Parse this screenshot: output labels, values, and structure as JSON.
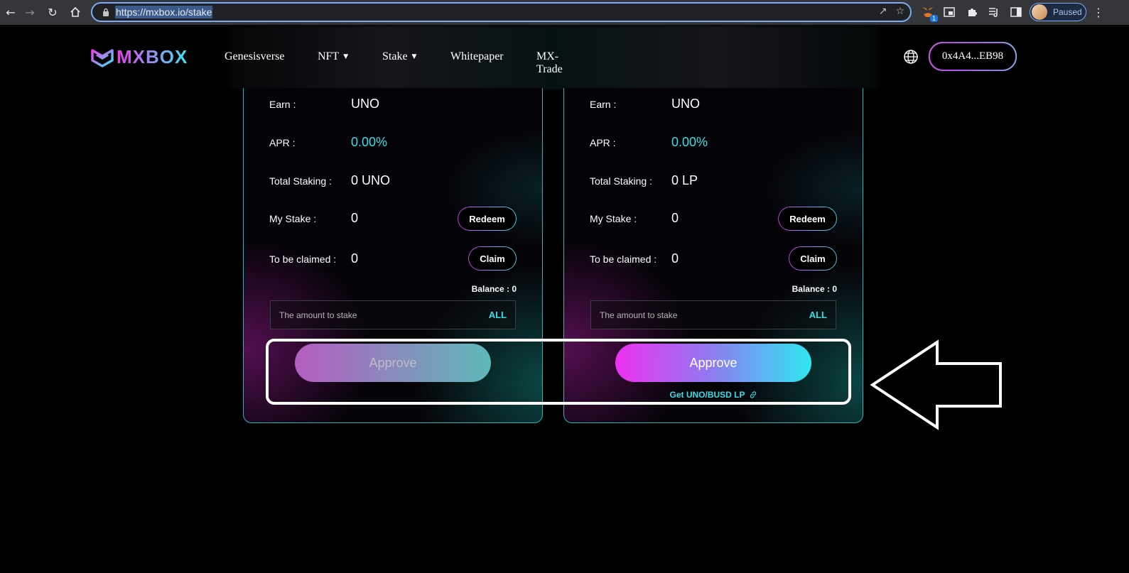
{
  "browser": {
    "url": "https://mxbox.io/stake",
    "profile_status": "Paused",
    "extension_badge": "1"
  },
  "site": {
    "logo_text": "MXBOX",
    "nav": [
      "Genesisverse",
      "NFT",
      "Stake",
      "Whitepaper",
      "MX-Trade"
    ],
    "wallet_address": "0x4A4...EB98"
  },
  "cards": [
    {
      "earn_label": "Earn :",
      "earn_value": "UNO",
      "apr_label": "APR :",
      "apr_value": "0.00%",
      "total_label": "Total Staking :",
      "total_value": "0 UNO",
      "mystake_label": "My Stake :",
      "mystake_value": "0",
      "redeem_label": "Redeem",
      "claimed_label": "To be claimed :",
      "claimed_value": "0",
      "claim_label": "Claim",
      "balance": "Balance : 0",
      "amount_placeholder": "The amount to stake",
      "all_label": "ALL",
      "approve_label": "Approve"
    },
    {
      "earn_label": "Earn :",
      "earn_value": "UNO",
      "apr_label": "APR :",
      "apr_value": "0.00%",
      "total_label": "Total Staking :",
      "total_value": "0 LP",
      "mystake_label": "My Stake :",
      "mystake_value": "0",
      "redeem_label": "Redeem",
      "claimed_label": "To be claimed :",
      "claimed_value": "0",
      "claim_label": "Claim",
      "balance": "Balance : 0",
      "amount_placeholder": "The amount to stake",
      "all_label": "ALL",
      "approve_label": "Approve",
      "get_lp_label": "Get UNO/BUSD LP"
    }
  ],
  "colors": {
    "accent_cyan": "#33e0ea",
    "accent_magenta": "#e93fe9",
    "card_border": "#2bb5b8"
  }
}
